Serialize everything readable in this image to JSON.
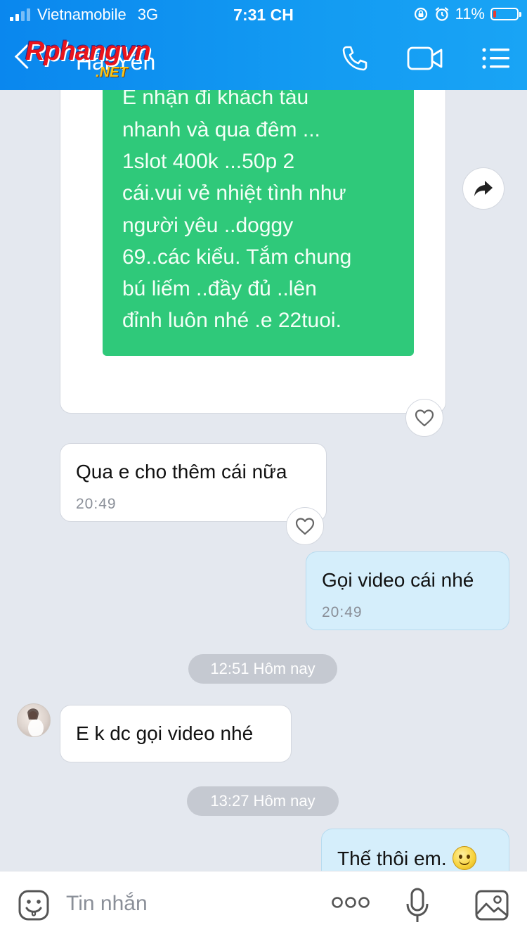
{
  "status_bar": {
    "carrier": "Vietnamobile",
    "network": "3G",
    "time": "7:31 CH",
    "battery": "11%",
    "battery_level": 0.11
  },
  "header": {
    "title": "Hải Yến",
    "watermark_main": "Rphangvn",
    "watermark_sub": ".NET",
    "icons": [
      "back-icon",
      "phone-icon",
      "video-call-icon",
      "menu-icon"
    ]
  },
  "messages": {
    "image_text": [
      "E nhận đi khách  tàu",
      "nhanh và qua đêm ...",
      "1slot 400k ...50p 2",
      "cái.vui vẻ nhiệt tình như",
      "người yêu ..doggy",
      "69..các kiểu. Tắm chung",
      "bú liếm ..đầy đủ ..lên",
      "đỉnh luôn nhé .e 22tuoi."
    ],
    "m1_text": "Qua e cho thêm cái nữa",
    "m1_time": "20:49",
    "m2_text": "Gọi video cái nhé",
    "m2_time": "20:49",
    "divider1": "12:51 Hôm nay",
    "m3_text": "E k dc gọi video nhé",
    "divider2": "13:27 Hôm nay",
    "m4_text": "Thế thôi em."
  },
  "input_bar": {
    "placeholder": "Tin nhắn",
    "icons": [
      "sticker-icon",
      "more-icon",
      "microphone-icon",
      "gallery-icon"
    ]
  },
  "colors": {
    "header": "#0a87ee",
    "image_bg": "#2fc97a",
    "outgoing_bubble": "#d5eefb",
    "incoming_bubble": "#ffffff",
    "chat_bg": "#e4e8ef"
  }
}
